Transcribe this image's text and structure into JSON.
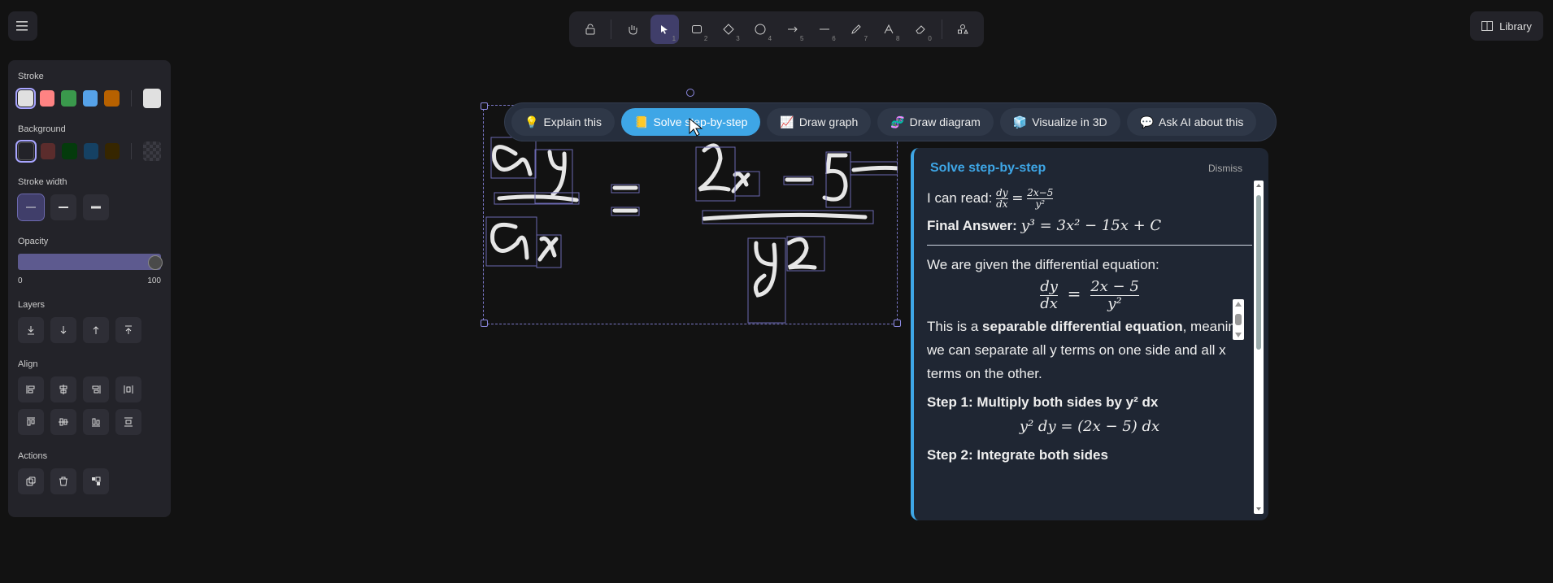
{
  "topbar": {
    "library_label": "Library"
  },
  "toolbar": {
    "tools": [
      {
        "name": "lock",
        "num": ""
      },
      {
        "name": "hand",
        "num": ""
      },
      {
        "name": "select",
        "num": "1"
      },
      {
        "name": "rectangle",
        "num": "2"
      },
      {
        "name": "diamond",
        "num": "3"
      },
      {
        "name": "ellipse",
        "num": "4"
      },
      {
        "name": "arrow",
        "num": "5"
      },
      {
        "name": "line",
        "num": "6"
      },
      {
        "name": "pencil",
        "num": "7"
      },
      {
        "name": "text",
        "num": "8"
      },
      {
        "name": "eraser",
        "num": "0"
      },
      {
        "name": "shapes",
        "num": ""
      }
    ]
  },
  "props": {
    "stroke_label": "Stroke",
    "stroke_colors": [
      "#e0e0e0",
      "#ff8383",
      "#3a994c",
      "#56a2e8",
      "#b76100"
    ],
    "stroke_picker": "#e0e0e0",
    "background_label": "Background",
    "background_colors": [
      "#232329",
      "#5b2c2c",
      "#043b0c",
      "#154163",
      "#362600"
    ],
    "stroke_width_label": "Stroke width",
    "opacity_label": "Opacity",
    "opacity_min": "0",
    "opacity_max": "100",
    "opacity_value": 100,
    "layers_label": "Layers",
    "align_label": "Align",
    "actions_label": "Actions"
  },
  "ai_bar": {
    "buttons": [
      {
        "icon": "💡",
        "label": "Explain this"
      },
      {
        "icon": "📒",
        "label": "Solve step-by-step"
      },
      {
        "icon": "📈",
        "label": "Draw graph"
      },
      {
        "icon": "🧬",
        "label": "Draw diagram"
      },
      {
        "icon": "🧊",
        "label": "Visualize in 3D"
      },
      {
        "icon": "💬",
        "label": "Ask AI about this"
      }
    ]
  },
  "solve_panel": {
    "title": "Solve step-by-step",
    "dismiss": "Dismiss",
    "i_can_read": "I can read:",
    "final_answer_label": "Final Answer:",
    "given_text": "We are given the differential equation:",
    "separable_pre": "This is a ",
    "separable_bold": "separable differential equation",
    "separable_post": ", meaning we can separate all y terms on one side and all x terms on the other.",
    "step1": "Step 1: Multiply both sides by y² dx",
    "step1_eq": "y² dy = (2x − 5) dx",
    "step2": "Step 2: Integrate both sides"
  }
}
